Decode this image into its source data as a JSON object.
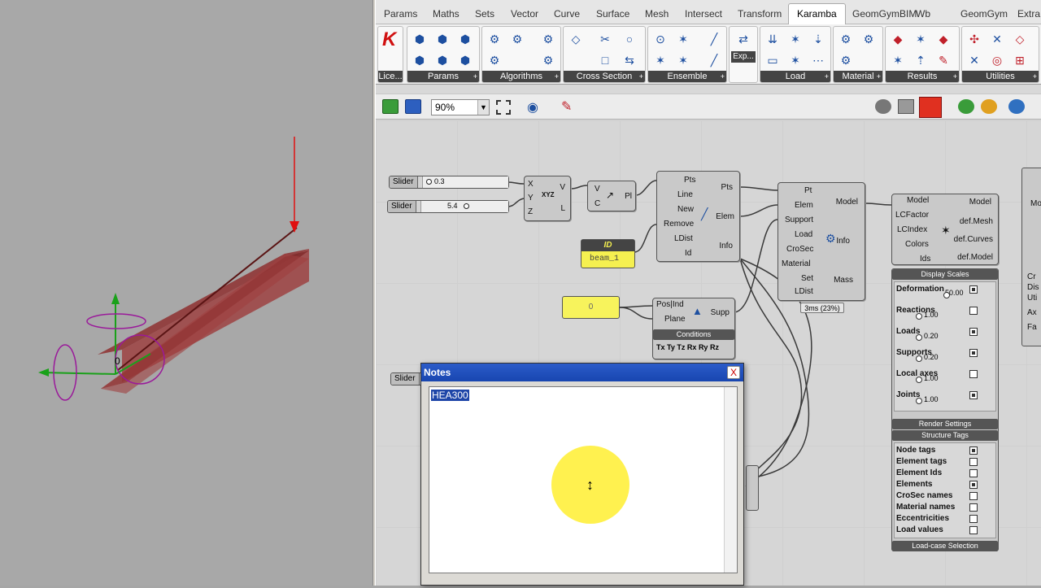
{
  "tabs": [
    "Params",
    "Maths",
    "Sets",
    "Vector",
    "Curve",
    "Surface",
    "Mesh",
    "Intersect",
    "Transform",
    "Karamba",
    "GeomGymBIM",
    "Wb",
    "GeomGym",
    "Extra"
  ],
  "active_tab": "Karamba",
  "ribbon": {
    "license_label": "Lice...",
    "export_label": "Exp...",
    "groups": [
      "Params",
      "Algorithms",
      "Cross Section",
      "Ensemble",
      "Load",
      "Material",
      "Results",
      "Utilities"
    ]
  },
  "toolbar": {
    "zoom": "90%"
  },
  "canvas": {
    "slider1": {
      "label": "Slider",
      "value": "0.3"
    },
    "slider2": {
      "label": "Slider",
      "value": "5.4"
    },
    "slider3": {
      "label": "Slider"
    },
    "vector": {
      "in": [
        "X",
        "Y",
        "Z"
      ],
      "out": [
        "V",
        "L"
      ],
      "glyph": "XYZ"
    },
    "point_line": {
      "in": [
        "V",
        "C"
      ],
      "out": "Pl"
    },
    "line_to_beam": {
      "in": [
        "Pts",
        "Line",
        "New",
        "Remove",
        "LDist",
        "Id"
      ],
      "out": [
        "Pts",
        "Elem",
        "Info"
      ]
    },
    "id_panel": {
      "title": "ID",
      "value": "beam_1"
    },
    "zero_panel": {
      "value": "0"
    },
    "support": {
      "in": [
        "Pos|Ind",
        "Plane"
      ],
      "out": "Supp",
      "conditions_title": "Conditions",
      "dofs": [
        "Tx",
        "Ty",
        "Tz",
        "Rx",
        "Ry",
        "Rz"
      ]
    },
    "assemble": {
      "in": [
        "Pt",
        "Elem",
        "Support",
        "Load",
        "CroSec",
        "Material",
        "Set",
        "LDist"
      ],
      "out": [
        "Model",
        "Info",
        "Mass"
      ],
      "timer": "3ms (23%)"
    },
    "model_view": {
      "in": [
        "Model",
        "LCFactor",
        "LCIndex",
        "Colors",
        "Ids"
      ],
      "out": [
        "Model",
        "def.Mesh",
        "def.Curves",
        "def.Model"
      ],
      "display_scales_title": "Display Scales",
      "scales": [
        {
          "label": "Deformation",
          "value": "50.00",
          "checked": true
        },
        {
          "label": "Reactions",
          "value": "1.00",
          "checked": false
        },
        {
          "label": "Loads",
          "value": "0.20",
          "checked": true
        },
        {
          "label": "Supports",
          "value": "0.20",
          "checked": true
        },
        {
          "label": "Local axes",
          "value": "1.00",
          "checked": false
        },
        {
          "label": "Joints",
          "value": "1.00",
          "checked": true
        }
      ],
      "render_settings_title": "Render Settings",
      "structure_tags_title": "Structure Tags",
      "tags": [
        {
          "label": "Node tags",
          "checked": true
        },
        {
          "label": "Element tags",
          "checked": false
        },
        {
          "label": "Element Ids",
          "checked": false
        },
        {
          "label": "Elements",
          "checked": true
        },
        {
          "label": "CroSec names",
          "checked": false
        },
        {
          "label": "Material names",
          "checked": false
        },
        {
          "label": "Eccentricities",
          "checked": false
        },
        {
          "label": "Load values",
          "checked": false
        }
      ],
      "loadcase_title": "Load-case Selection"
    },
    "right_partial": {
      "labels": [
        "Mo",
        "Cr",
        "Dis",
        "Uti",
        "Ax",
        "Fa"
      ]
    }
  },
  "notes": {
    "title": "Notes",
    "text": "HEA300",
    "close": "X"
  },
  "colors": {
    "accent": "#1e46a8",
    "panel_yellow": "#f7f35c",
    "beam": "#8b2a2a",
    "load_arrow": "#e01010"
  },
  "icons": [
    "close-icon",
    "folder-icon",
    "save-icon",
    "eye-icon",
    "text-cursor-icon"
  ]
}
